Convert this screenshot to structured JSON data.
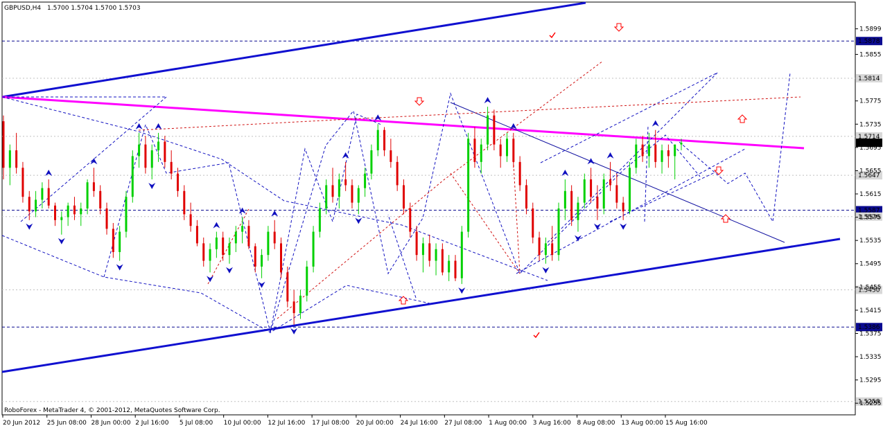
{
  "header": {
    "symbol": "GBPUSD,H4",
    "ohlc": "1.5700 1.5704 1.5700 1.5703"
  },
  "footer": {
    "copyright": "RoboForex - MetaTrader 4, © 2001-2012, MetaQuotes Software Corp."
  },
  "colors": {
    "background": "#ffffff",
    "bull": "#00d000",
    "bear": "#e00000",
    "channel": "#1010d0",
    "magenta_line": "#ff00ff",
    "arrow_up": "#ff0000",
    "fractal": "#1010c0",
    "grid": "#c0c0c0"
  },
  "chart_data": {
    "type": "candlestick",
    "timeframe": "H4",
    "ylim": [
      1.5235,
      1.5945
    ],
    "y_ticks": [
      "1.5899",
      "1.5855",
      "1.5775",
      "1.5735",
      "1.5695",
      "1.5655",
      "1.5615",
      "1.5575",
      "1.5535",
      "1.5495",
      "1.5455",
      "1.5415",
      "1.5375",
      "1.5335",
      "1.5295",
      "1.5255"
    ],
    "x_labels": [
      "20 Jun 2012",
      "25 Jun 08:00",
      "28 Jun 00:00",
      "2 Jul 16:00",
      "5 Jul 08:00",
      "10 Jul 00:00",
      "12 Jul 16:00",
      "17 Jul 08:00",
      "20 Jul 00:00",
      "24 Jul 16:00",
      "27 Jul 08:00",
      "1 Aug 00:00",
      "3 Aug 16:00",
      "8 Aug 08:00",
      "13 Aug 00:00",
      "15 Aug 16:00"
    ],
    "price_levels": [
      {
        "value": 1.5878,
        "label": "1.5878",
        "style": "dashed-blue",
        "boxed": true
      },
      {
        "value": 1.5814,
        "label": "1.5814",
        "style": "dotted-gray",
        "boxed": true
      },
      {
        "value": 1.5714,
        "label": "1.5714",
        "style": "dotted-gray",
        "boxed": true
      },
      {
        "value": 1.5703,
        "label": "1.5703",
        "style": "current",
        "boxed": true
      },
      {
        "value": 1.5647,
        "label": "1.5647",
        "style": "dotted-gray",
        "boxed": true
      },
      {
        "value": 1.5587,
        "label": "1.5587",
        "style": "dashed-blue",
        "boxed": true
      },
      {
        "value": 1.5576,
        "label": "1.5576",
        "style": "dotted-gray",
        "boxed": true
      },
      {
        "value": 1.545,
        "label": "1.5450",
        "style": "dotted-gray",
        "boxed": true
      },
      {
        "value": 1.5386,
        "label": "1.5386",
        "style": "dashed-blue",
        "boxed": true
      },
      {
        "value": 1.5258,
        "label": "1.5258",
        "style": "dotted-gray",
        "boxed": true
      }
    ],
    "candles": [
      [
        1.574,
        1.575,
        1.564,
        1.566
      ],
      [
        1.566,
        1.57,
        1.563,
        1.569
      ],
      [
        1.569,
        1.572,
        1.565,
        1.566
      ],
      [
        1.566,
        1.567,
        1.56,
        1.561
      ],
      [
        1.561,
        1.562,
        1.557,
        1.5585
      ],
      [
        1.5585,
        1.562,
        1.5575,
        1.5605
      ],
      [
        1.5605,
        1.5635,
        1.559,
        1.5625
      ],
      [
        1.5625,
        1.564,
        1.559,
        1.5595
      ],
      [
        1.5595,
        1.56,
        1.556,
        1.557
      ],
      [
        1.557,
        1.5585,
        1.5545,
        1.5575
      ],
      [
        1.5575,
        1.56,
        1.556,
        1.5595
      ],
      [
        1.5595,
        1.561,
        1.557,
        1.558
      ],
      [
        1.558,
        1.56,
        1.556,
        1.559
      ],
      [
        1.559,
        1.564,
        1.558,
        1.5635
      ],
      [
        1.5635,
        1.566,
        1.561,
        1.562
      ],
      [
        1.562,
        1.563,
        1.558,
        1.559
      ],
      [
        1.559,
        1.56,
        1.5545,
        1.5555
      ],
      [
        1.5555,
        1.5565,
        1.5505,
        1.5515
      ],
      [
        1.5515,
        1.556,
        1.55,
        1.555
      ],
      [
        1.555,
        1.562,
        1.554,
        1.561
      ],
      [
        1.561,
        1.569,
        1.56,
        1.568
      ],
      [
        1.568,
        1.572,
        1.566,
        1.57
      ],
      [
        1.57,
        1.5715,
        1.565,
        1.566
      ],
      [
        1.566,
        1.57,
        1.564,
        1.569
      ],
      [
        1.569,
        1.572,
        1.567,
        1.5705
      ],
      [
        1.5705,
        1.5715,
        1.566,
        1.567
      ],
      [
        1.567,
        1.569,
        1.564,
        1.565
      ],
      [
        1.565,
        1.566,
        1.561,
        1.562
      ],
      [
        1.562,
        1.563,
        1.557,
        1.558
      ],
      [
        1.558,
        1.56,
        1.555,
        1.556
      ],
      [
        1.556,
        1.557,
        1.5525,
        1.553
      ],
      [
        1.553,
        1.554,
        1.549,
        1.55
      ],
      [
        1.55,
        1.553,
        1.548,
        1.552
      ],
      [
        1.552,
        1.555,
        1.5505,
        1.554
      ],
      [
        1.554,
        1.555,
        1.55,
        1.551
      ],
      [
        1.551,
        1.554,
        1.5495,
        1.553
      ],
      [
        1.553,
        1.556,
        1.5515,
        1.555
      ],
      [
        1.555,
        1.5575,
        1.553,
        1.556
      ],
      [
        1.556,
        1.557,
        1.552,
        1.5525
      ],
      [
        1.5525,
        1.553,
        1.548,
        1.549
      ],
      [
        1.549,
        1.552,
        1.547,
        1.551
      ],
      [
        1.551,
        1.556,
        1.55,
        1.555
      ],
      [
        1.555,
        1.557,
        1.552,
        1.553
      ],
      [
        1.553,
        1.554,
        1.547,
        1.548
      ],
      [
        1.548,
        1.549,
        1.542,
        1.543
      ],
      [
        1.543,
        1.545,
        1.539,
        1.541
      ],
      [
        1.541,
        1.545,
        1.54,
        1.544
      ],
      [
        1.544,
        1.55,
        1.543,
        1.549
      ],
      [
        1.549,
        1.556,
        1.548,
        1.555
      ],
      [
        1.555,
        1.56,
        1.554,
        1.559
      ],
      [
        1.559,
        1.564,
        1.558,
        1.563
      ],
      [
        1.563,
        1.566,
        1.56,
        1.561
      ],
      [
        1.561,
        1.565,
        1.559,
        1.564
      ],
      [
        1.564,
        1.567,
        1.562,
        1.563
      ],
      [
        1.563,
        1.564,
        1.559,
        1.56
      ],
      [
        1.56,
        1.563,
        1.558,
        1.5625
      ],
      [
        1.5625,
        1.566,
        1.561,
        1.565
      ],
      [
        1.565,
        1.57,
        1.564,
        1.569
      ],
      [
        1.569,
        1.5735,
        1.568,
        1.5725
      ],
      [
        1.5725,
        1.573,
        1.568,
        1.569
      ],
      [
        1.569,
        1.571,
        1.566,
        1.567
      ],
      [
        1.567,
        1.568,
        1.562,
        1.563
      ],
      [
        1.563,
        1.564,
        1.558,
        1.559
      ],
      [
        1.559,
        1.56,
        1.554,
        1.555
      ],
      [
        1.555,
        1.556,
        1.55,
        1.551
      ],
      [
        1.551,
        1.554,
        1.548,
        1.553
      ],
      [
        1.553,
        1.5545,
        1.549,
        1.55
      ],
      [
        1.55,
        1.553,
        1.5475,
        1.552
      ],
      [
        1.552,
        1.553,
        1.5475,
        1.548
      ],
      [
        1.548,
        1.551,
        1.5465,
        1.55
      ],
      [
        1.55,
        1.551,
        1.5465,
        1.547
      ],
      [
        1.547,
        1.556,
        1.546,
        1.555
      ],
      [
        1.555,
        1.572,
        1.554,
        1.571
      ],
      [
        1.571,
        1.573,
        1.566,
        1.567
      ],
      [
        1.567,
        1.571,
        1.565,
        1.57
      ],
      [
        1.57,
        1.5765,
        1.569,
        1.575
      ],
      [
        1.575,
        1.576,
        1.569,
        1.57
      ],
      [
        1.57,
        1.571,
        1.566,
        1.568
      ],
      [
        1.568,
        1.572,
        1.567,
        1.571
      ],
      [
        1.571,
        1.572,
        1.566,
        1.567
      ],
      [
        1.567,
        1.568,
        1.562,
        1.563
      ],
      [
        1.563,
        1.564,
        1.558,
        1.559
      ],
      [
        1.559,
        1.56,
        1.553,
        1.554
      ],
      [
        1.554,
        1.555,
        1.55,
        1.551
      ],
      [
        1.551,
        1.554,
        1.5495,
        1.553
      ],
      [
        1.553,
        1.556,
        1.55,
        1.551
      ],
      [
        1.551,
        1.56,
        1.55,
        1.559
      ],
      [
        1.559,
        1.564,
        1.557,
        1.562
      ],
      [
        1.562,
        1.563,
        1.556,
        1.557
      ],
      [
        1.557,
        1.561,
        1.555,
        1.56
      ],
      [
        1.56,
        1.565,
        1.559,
        1.564
      ],
      [
        1.564,
        1.566,
        1.56,
        1.561
      ],
      [
        1.561,
        1.563,
        1.557,
        1.559
      ],
      [
        1.559,
        1.565,
        1.558,
        1.564
      ],
      [
        1.564,
        1.567,
        1.562,
        1.563
      ],
      [
        1.563,
        1.565,
        1.559,
        1.56
      ],
      [
        1.56,
        1.561,
        1.557,
        1.5585
      ],
      [
        1.5585,
        1.567,
        1.558,
        1.566
      ],
      [
        1.566,
        1.571,
        1.565,
        1.57
      ],
      [
        1.57,
        1.5715,
        1.567,
        1.568
      ],
      [
        1.568,
        1.572,
        1.566,
        1.57
      ],
      [
        1.57,
        1.5725,
        1.566,
        1.567
      ],
      [
        1.567,
        1.57,
        1.565,
        1.569
      ],
      [
        1.569,
        1.57,
        1.566,
        1.568
      ],
      [
        1.568,
        1.57,
        1.564,
        1.57
      ],
      [
        1.57,
        1.571,
        1.569,
        1.5703
      ]
    ]
  }
}
